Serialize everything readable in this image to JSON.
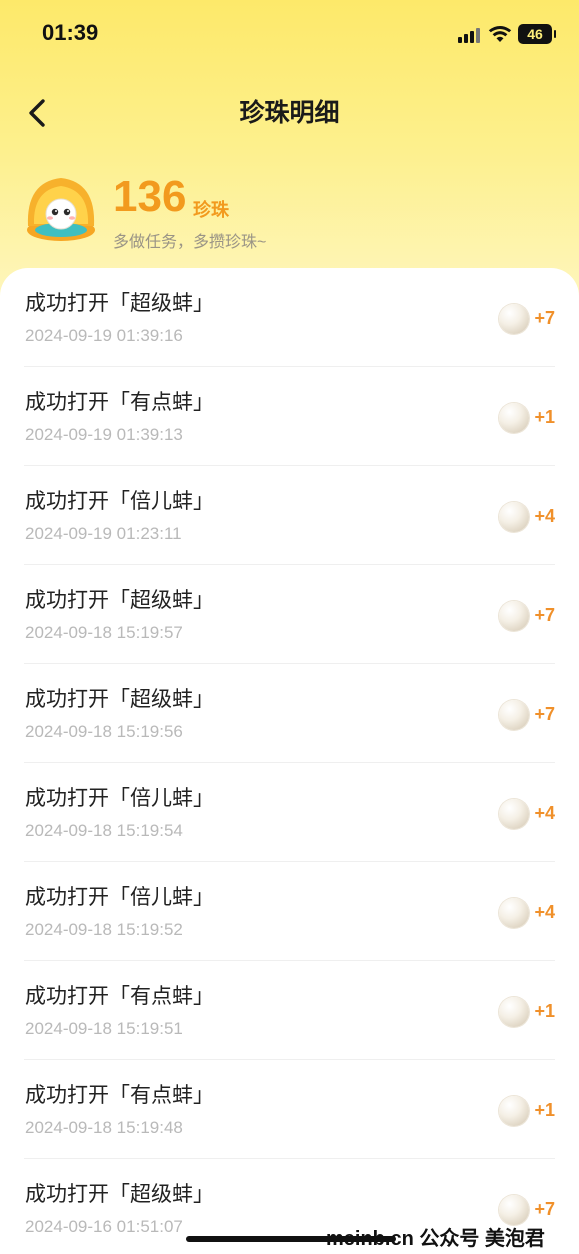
{
  "status_bar": {
    "time": "01:39",
    "battery": "46"
  },
  "header": {
    "title": "珍珠明细"
  },
  "summary": {
    "count": "136",
    "unit": "珍珠",
    "tip": "多做任务，多攒珍珠~"
  },
  "records": [
    {
      "title": "成功打开「超级蚌」",
      "time": "2024-09-19 01:39:16",
      "amount": "+7"
    },
    {
      "title": "成功打开「有点蚌」",
      "time": "2024-09-19 01:39:13",
      "amount": "+1"
    },
    {
      "title": "成功打开「倍儿蚌」",
      "time": "2024-09-19 01:23:11",
      "amount": "+4"
    },
    {
      "title": "成功打开「超级蚌」",
      "time": "2024-09-18 15:19:57",
      "amount": "+7"
    },
    {
      "title": "成功打开「超级蚌」",
      "time": "2024-09-18 15:19:56",
      "amount": "+7"
    },
    {
      "title": "成功打开「倍儿蚌」",
      "time": "2024-09-18 15:19:54",
      "amount": "+4"
    },
    {
      "title": "成功打开「倍儿蚌」",
      "time": "2024-09-18 15:19:52",
      "amount": "+4"
    },
    {
      "title": "成功打开「有点蚌」",
      "time": "2024-09-18 15:19:51",
      "amount": "+1"
    },
    {
      "title": "成功打开「有点蚌」",
      "time": "2024-09-18 15:19:48",
      "amount": "+1"
    },
    {
      "title": "成功打开「超级蚌」",
      "time": "2024-09-16 01:51:07",
      "amount": "+7"
    }
  ],
  "watermark": "meinb.cn  公众号 美泡君",
  "icons": [
    "back-chevron-icon",
    "signal-icon",
    "wifi-icon",
    "battery-icon",
    "pearl-icon",
    "clam-mascot-icon"
  ],
  "colors": {
    "accent": "#f29a1e",
    "header_bg": "#fde96a"
  }
}
